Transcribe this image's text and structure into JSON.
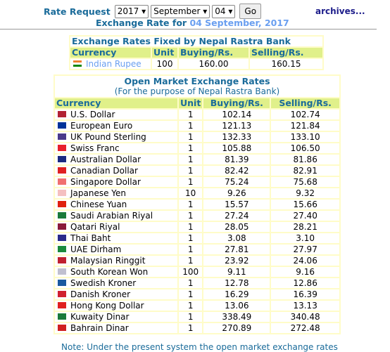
{
  "header": {
    "rate_request_label": "Rate Request",
    "year": "2017",
    "month": "September",
    "day": "04",
    "go_label": "Go",
    "archives_link": "archives...",
    "exchange_rate_for": "Exchange Rate for",
    "date": "04 September, 2017"
  },
  "fixed": {
    "title": "Exchange Rates Fixed by Nepal Rastra Bank",
    "columns": [
      "Currency",
      "Unit",
      "Buying/Rs.",
      "Selling/Rs."
    ],
    "row": {
      "currency": "Indian Rupee",
      "unit": "100",
      "buying": "160.00",
      "selling": "160.15",
      "flag": "#f08030"
    }
  },
  "open": {
    "title": "Open Market Exchange Rates",
    "subtitle": "(For the purpose of Nepal Rastra Bank)",
    "columns": [
      "Currency",
      "Unit",
      "Buying/Rs.",
      "Selling/Rs."
    ],
    "rows": [
      {
        "currency": "U.S. Dollar",
        "unit": "1",
        "buying": "102.14",
        "selling": "102.74",
        "flag": "#b22234"
      },
      {
        "currency": "European Euro",
        "unit": "1",
        "buying": "121.13",
        "selling": "121.84",
        "flag": "#003399"
      },
      {
        "currency": "UK Pound Sterling",
        "unit": "1",
        "buying": "132.33",
        "selling": "133.10",
        "flag": "#4a3a8a"
      },
      {
        "currency": "Swiss Franc",
        "unit": "1",
        "buying": "105.88",
        "selling": "106.50",
        "flag": "#e8202a"
      },
      {
        "currency": "Australian Dollar",
        "unit": "1",
        "buying": "81.39",
        "selling": "81.86",
        "flag": "#1a2a80"
      },
      {
        "currency": "Canadian Dollar",
        "unit": "1",
        "buying": "82.42",
        "selling": "82.91",
        "flag": "#e02020"
      },
      {
        "currency": "Singapore Dollar",
        "unit": "1",
        "buying": "75.24",
        "selling": "75.68",
        "flag": "#f07070"
      },
      {
        "currency": "Japanese Yen",
        "unit": "10",
        "buying": "9.26",
        "selling": "9.32",
        "flag": "#f4c0c0"
      },
      {
        "currency": "Chinese Yuan",
        "unit": "1",
        "buying": "15.57",
        "selling": "15.66",
        "flag": "#e02010"
      },
      {
        "currency": "Saudi Arabian Riyal",
        "unit": "1",
        "buying": "27.24",
        "selling": "27.40",
        "flag": "#1a7a3a"
      },
      {
        "currency": "Qatari Riyal",
        "unit": "1",
        "buying": "28.05",
        "selling": "28.21",
        "flag": "#8a1a3a"
      },
      {
        "currency": "Thai Baht",
        "unit": "1",
        "buying": "3.08",
        "selling": "3.10",
        "flag": "#2a2a8a"
      },
      {
        "currency": "UAE Dirham",
        "unit": "1",
        "buying": "27.81",
        "selling": "27.97",
        "flag": "#1a8a3a"
      },
      {
        "currency": "Malaysian Ringgit",
        "unit": "1",
        "buying": "23.92",
        "selling": "24.06",
        "flag": "#c02030"
      },
      {
        "currency": "South Korean Won",
        "unit": "100",
        "buying": "9.11",
        "selling": "9.16",
        "flag": "#c0c0d0"
      },
      {
        "currency": "Swedish Kroner",
        "unit": "1",
        "buying": "12.78",
        "selling": "12.86",
        "flag": "#1a5aa0"
      },
      {
        "currency": "Danish Kroner",
        "unit": "1",
        "buying": "16.29",
        "selling": "16.39",
        "flag": "#d02030"
      },
      {
        "currency": "Hong Kong Dollar",
        "unit": "1",
        "buying": "13.06",
        "selling": "13.13",
        "flag": "#e02020"
      },
      {
        "currency": "Kuwaity Dinar",
        "unit": "1",
        "buying": "338.49",
        "selling": "340.48",
        "flag": "#1a7a3a"
      },
      {
        "currency": "Bahrain Dinar",
        "unit": "1",
        "buying": "270.89",
        "selling": "272.48",
        "flag": "#d02020"
      }
    ]
  },
  "note": "Note: Under the present system the open market exchange rates"
}
